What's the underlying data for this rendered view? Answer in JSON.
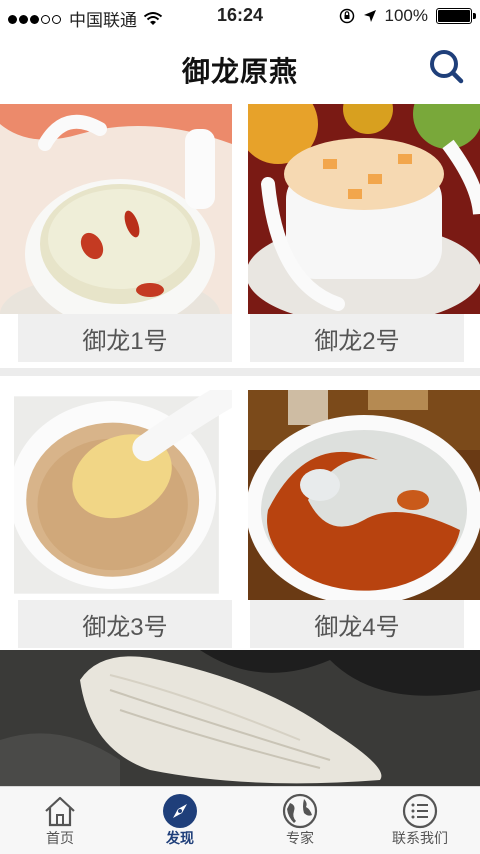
{
  "status_bar": {
    "carrier": "中国联通",
    "time": "16:24",
    "battery": "100%"
  },
  "header": {
    "title": "御龙原燕",
    "search_icon": "search-icon"
  },
  "products": [
    {
      "label": "御龙1号"
    },
    {
      "label": "御龙2号"
    },
    {
      "label": "御龙3号"
    },
    {
      "label": "御龙4号"
    }
  ],
  "tabbar": {
    "items": [
      {
        "label": "首页",
        "icon": "home-icon"
      },
      {
        "label": "发现",
        "icon": "compass-icon"
      },
      {
        "label": "专家",
        "icon": "globe-icon"
      },
      {
        "label": "联系我们",
        "icon": "list-icon"
      }
    ],
    "active_index": 1
  },
  "colors": {
    "accent": "#1f3f7a",
    "tab_background": "#f7f7f7",
    "label_background": "#efefef"
  }
}
